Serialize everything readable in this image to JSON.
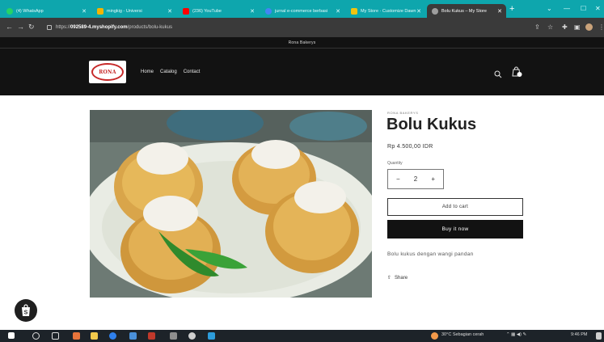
{
  "browser": {
    "tabs": [
      {
        "label": "(4) WhatsApp",
        "fav_color": "#25d366"
      },
      {
        "label": "mingkig - Universi",
        "fav_color": "#f4b400"
      },
      {
        "label": "(236) YouTube",
        "fav_color": "#ff0000"
      },
      {
        "label": "jurnal e-commerce berbasi",
        "fav_color": "#4285f4"
      },
      {
        "label": "My Store · Customize Dawn",
        "fav_color": "#f1c40f"
      },
      {
        "label": "Bolu Kukus – My Store",
        "fav_color": "#9e9e9e",
        "active": true
      }
    ],
    "new_tab": "+",
    "url_prefix": "https://",
    "url_host": "092589-4.myshopify.com",
    "url_path": "/products/bolu-kukus"
  },
  "store": {
    "announcement": "Rona Bakerys",
    "logo_text": "RONA",
    "menu": [
      "Home",
      "Catalog",
      "Contact"
    ]
  },
  "product": {
    "vendor": "RONA BAKERYS",
    "title": "Bolu Kukus",
    "price": "Rp 4.500,00 IDR",
    "quantity_label": "Quantity",
    "quantity_value": "2",
    "minus": "−",
    "plus": "+",
    "add_to_cart": "Add to cart",
    "buy_now": "Buy it now",
    "description": "Bolu kukus dengan wangi pandan",
    "share": "Share"
  },
  "taskbar": {
    "weather": "30°C  Sebagian cerah",
    "time": "9:46 PM"
  }
}
